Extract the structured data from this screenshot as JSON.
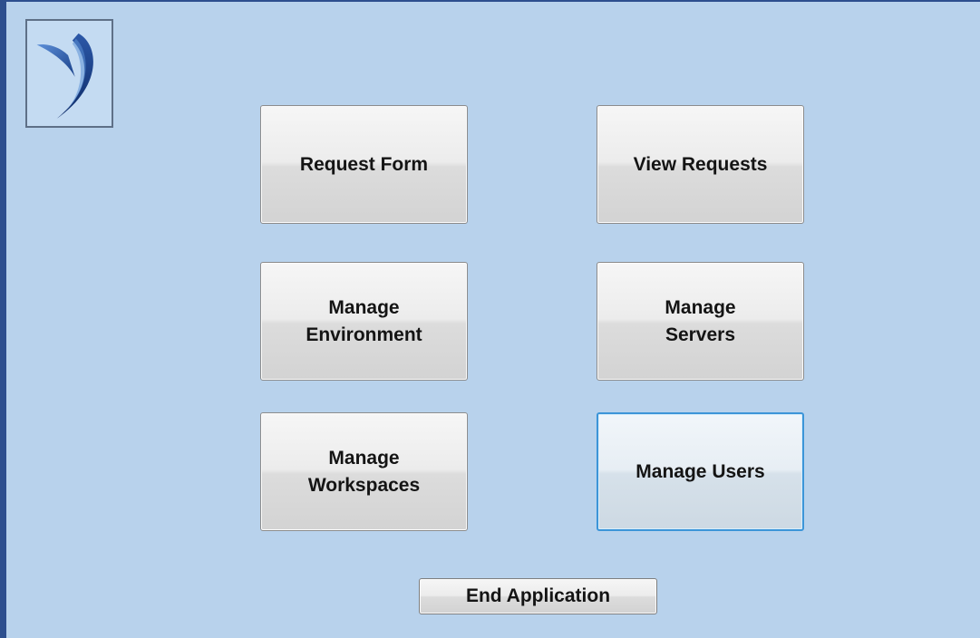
{
  "logo": {
    "icon": "company-logo-icon"
  },
  "buttons": {
    "request_form": "Request Form",
    "view_requests": "View Requests",
    "manage_environment": "Manage\nEnvironment",
    "manage_servers": "Manage\nServers",
    "manage_workspaces": "Manage\nWorkspaces",
    "manage_users": "Manage Users"
  },
  "end_button": "End Application",
  "colors": {
    "background": "#b8d2ec",
    "window_border": "#2d4f8e",
    "focus_border": "#3c95d8",
    "logo_blue": "#2a5fb0"
  }
}
